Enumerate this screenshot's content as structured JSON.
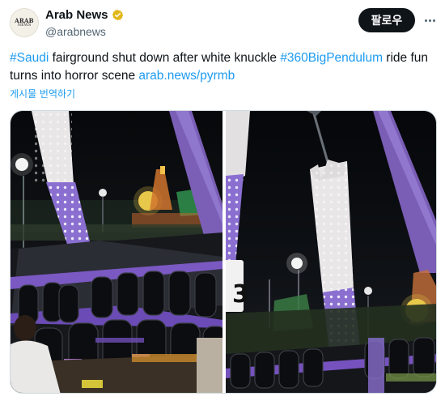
{
  "author": {
    "display_name": "Arab News",
    "handle": "@arabnews",
    "avatar_text": "ARAB",
    "avatar_subtext": "NEWS",
    "verified_color": "#e2b719"
  },
  "actions": {
    "follow_label": "팔로우"
  },
  "tweet": {
    "hashtag_1": "#Saudi",
    "text_1": " fairground shut down after white knuckle ",
    "hashtag_2": "#360BigPendulum",
    "text_2": " ride fun turns into horror scene ",
    "link": "arab.news/pyrmb",
    "translate_label": "게시물 번역하기"
  },
  "media": {
    "count": 2,
    "overlay_number": "3"
  },
  "colors": {
    "link": "#1d9bf0",
    "text": "#0f1419",
    "secondary": "#536471",
    "ride_purple": "#8f6fd1"
  }
}
